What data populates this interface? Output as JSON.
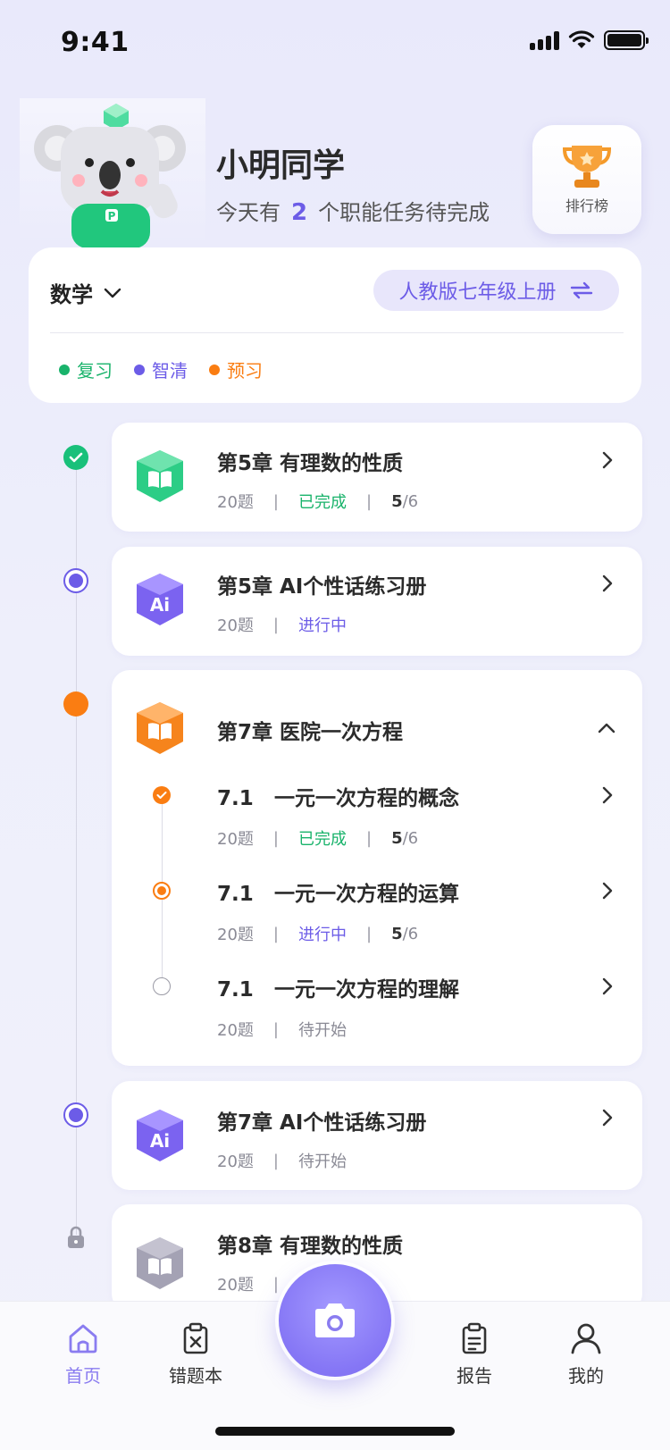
{
  "status_bar": {
    "time": "9:41"
  },
  "header": {
    "user_name": "小明同学",
    "task_prefix": "今天有",
    "task_count": "2",
    "task_suffix": "个职能任务待完成",
    "rank_label": "排行榜"
  },
  "subject": {
    "name": "数学",
    "edition": "人教版七年级上册",
    "legend": [
      {
        "label": "复习",
        "color": "#19b36b"
      },
      {
        "label": "智清",
        "color": "#6c5ce7"
      },
      {
        "label": "预习",
        "color": "#fa7d12"
      }
    ]
  },
  "chapters": [
    {
      "title": "第5章  有理数的性质",
      "count": "20题",
      "status": "已完成",
      "progress_done": "5",
      "progress_total": "/6",
      "icon": "book-icon-green"
    },
    {
      "title": "第5章  AI个性话练习册",
      "count": "20题",
      "status": "进行中",
      "icon": "ai-icon-purple"
    },
    {
      "title": "第7章  医院一次方程",
      "icon": "book-icon-orange",
      "lessons": [
        {
          "num": "7.1",
          "title": "一元一次方程的概念",
          "count": "20题",
          "status": "已完成",
          "progress_done": "5",
          "progress_total": "/6"
        },
        {
          "num": "7.1",
          "title": "一元一次方程的运算",
          "count": "20题",
          "status": "进行中",
          "progress_done": "5",
          "progress_total": "/6"
        },
        {
          "num": "7.1",
          "title": "一元一次方程的理解",
          "count": "20题",
          "status": "待开始"
        }
      ]
    },
    {
      "title": "第7章  AI个性话练习册",
      "count": "20题",
      "status": "待开始",
      "icon": "ai-icon-purple"
    },
    {
      "title": "第8章  有理数的性质",
      "count": "20题",
      "icon": "book-icon-gray",
      "locked": true
    }
  ],
  "bottom_nav": {
    "home": "首页",
    "mistakes": "错题本",
    "report": "报告",
    "mine": "我的"
  }
}
